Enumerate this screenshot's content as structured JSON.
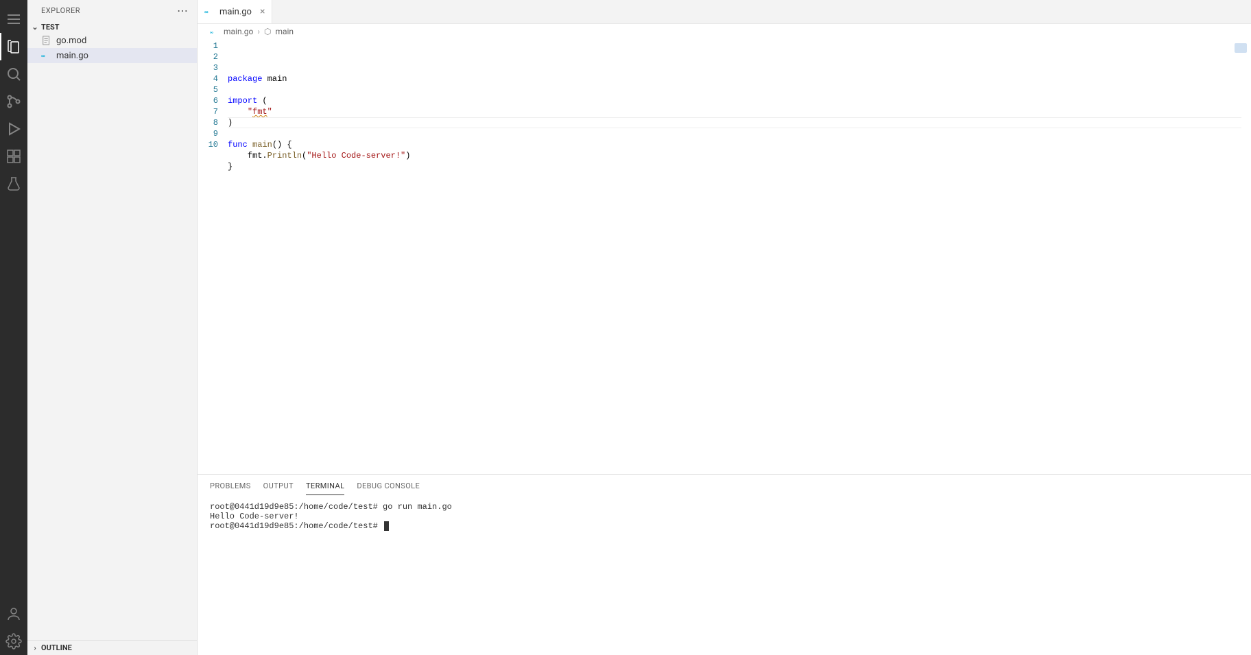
{
  "sidebar": {
    "title": "EXPLORER",
    "project": "TEST",
    "files": [
      {
        "name": "go.mod",
        "type": "text"
      },
      {
        "name": "main.go",
        "type": "go",
        "selected": true
      }
    ],
    "outline": "OUTLINE"
  },
  "tab": {
    "label": "main.go"
  },
  "breadcrumbs": {
    "file": "main.go",
    "symbol": "main"
  },
  "code": {
    "lines": [
      {
        "n": 1,
        "segments": [
          {
            "t": "package ",
            "c": "kw"
          },
          {
            "t": "main",
            "c": "ident"
          }
        ]
      },
      {
        "n": 2,
        "segments": []
      },
      {
        "n": 3,
        "segments": [
          {
            "t": "import ",
            "c": "kw"
          },
          {
            "t": "(",
            "c": "paren"
          }
        ]
      },
      {
        "n": 4,
        "segments": [
          {
            "t": "    ",
            "c": ""
          },
          {
            "t": "\"",
            "c": "str"
          },
          {
            "t": "fmt",
            "c": "str fmt-underline"
          },
          {
            "t": "\"",
            "c": "str"
          }
        ]
      },
      {
        "n": 5,
        "segments": [
          {
            "t": ")",
            "c": "paren"
          }
        ]
      },
      {
        "n": 6,
        "segments": []
      },
      {
        "n": 7,
        "segments": [
          {
            "t": "func ",
            "c": "kw"
          },
          {
            "t": "main",
            "c": "fn"
          },
          {
            "t": "() {",
            "c": "paren"
          }
        ]
      },
      {
        "n": 8,
        "segments": [
          {
            "t": "    fmt.",
            "c": "ident"
          },
          {
            "t": "Println",
            "c": "fn"
          },
          {
            "t": "(",
            "c": "paren"
          },
          {
            "t": "\"Hello Code-server!\"",
            "c": "str"
          },
          {
            "t": ")",
            "c": "paren"
          }
        ]
      },
      {
        "n": 9,
        "segments": [
          {
            "t": "}",
            "c": "paren"
          }
        ]
      },
      {
        "n": 10,
        "segments": []
      }
    ],
    "highlighted_line": 8
  },
  "panel": {
    "tabs": [
      "PROBLEMS",
      "OUTPUT",
      "TERMINAL",
      "DEBUG CONSOLE"
    ],
    "active": "TERMINAL"
  },
  "terminal": {
    "lines": [
      "root@0441d19d9e85:/home/code/test# go run main.go",
      "Hello Code-server!",
      "root@0441d19d9e85:/home/code/test# "
    ]
  },
  "activity": [
    {
      "id": "menu",
      "active": false
    },
    {
      "id": "explorer",
      "active": true
    },
    {
      "id": "search",
      "active": false
    },
    {
      "id": "scm",
      "active": false
    },
    {
      "id": "debug",
      "active": false
    },
    {
      "id": "extensions",
      "active": false
    },
    {
      "id": "testing",
      "active": false
    }
  ]
}
